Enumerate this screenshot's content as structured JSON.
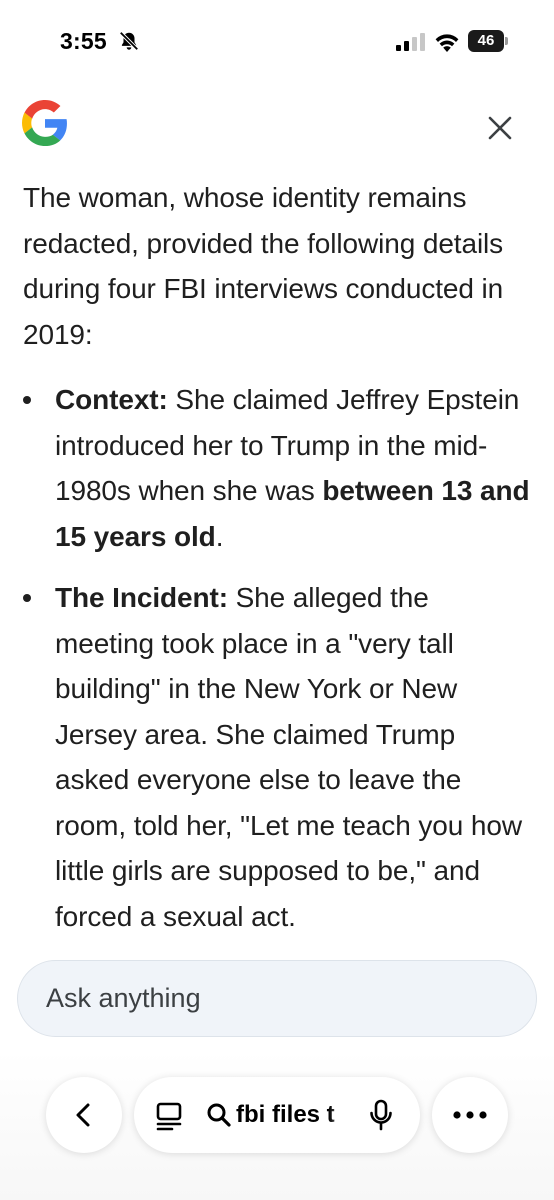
{
  "status_bar": {
    "time": "3:55",
    "battery_level": "46",
    "icons": [
      "bell-off-icon",
      "signal-icon",
      "wifi-icon",
      "battery-icon"
    ]
  },
  "header": {
    "logo": "google-logo-icon",
    "close_icon": "close-icon"
  },
  "answer": {
    "intro": "The woman, whose identity remains redacted, provided the following details during four FBI interviews conducted in 2019:",
    "bullets": [
      {
        "label": "Context:",
        "text_before": " She claimed Jeffrey Epstein introduced her to Trump in the mid-1980s when she was ",
        "bold_text": "between 13 and 15 years old",
        "text_after": "."
      },
      {
        "label": "The Incident:",
        "text_before": " She alleged the meeting took place in a \"very tall building\" in the New York or New Jersey area. She claimed Trump asked everyone else to leave the room, told her, \"Let me teach you how little girls are supposed to be,\" and forced a sexual act.",
        "bold_text": "",
        "text_after": ""
      }
    ]
  },
  "ask_bar": {
    "placeholder": "Ask anything",
    "value": ""
  },
  "bottom_bar": {
    "url_text": "fbi files t",
    "more_label": "•••",
    "icons": [
      "back-icon",
      "tabs-icon",
      "search-icon",
      "mic-icon",
      "more-icon"
    ]
  },
  "colors": {
    "text": "#1f1f1f",
    "ask_bar_bg": "#f0f4f9",
    "google_blue": "#4285F4",
    "google_red": "#EA4335",
    "google_yellow": "#FBBC05",
    "google_green": "#34A853"
  }
}
